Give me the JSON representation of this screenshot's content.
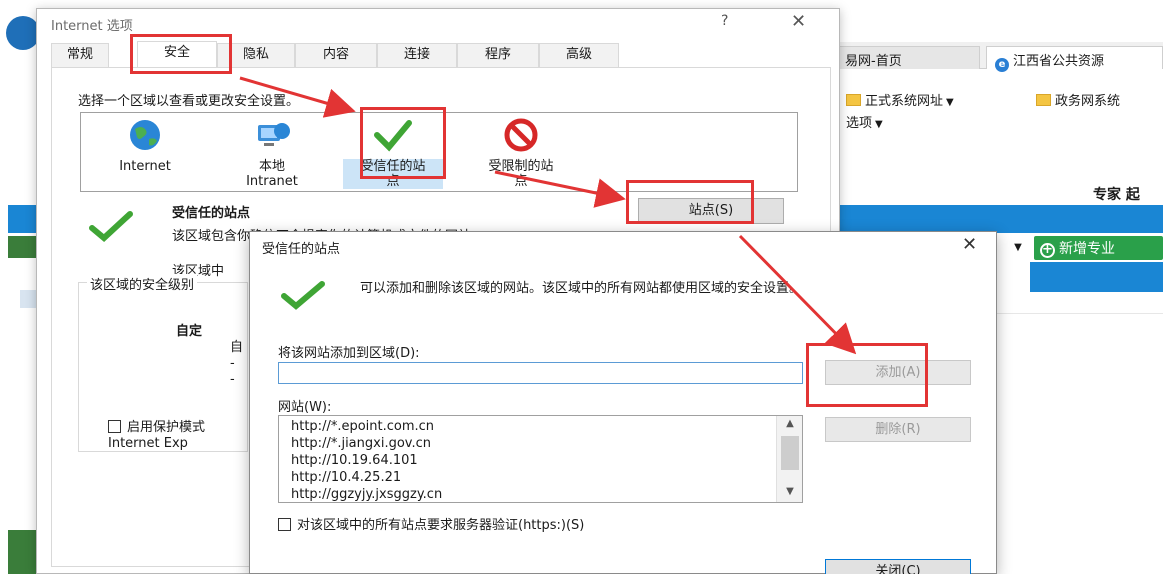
{
  "background_browser": {
    "tabs": [
      {
        "label": "易网-首页",
        "active": false
      },
      {
        "label": "江西省公共资源",
        "active": true
      }
    ],
    "favorites": [
      {
        "label": "正式系统网址"
      },
      {
        "label": "政务网系统"
      }
    ],
    "command_bar": {
      "label": "选项"
    },
    "brand_text": "专家 起",
    "add_button_label": "新增专业"
  },
  "internet_options": {
    "title": "Internet 选项",
    "help_glyph": "?",
    "close_glyph": "✕",
    "tabs": [
      "常规",
      "安全",
      "隐私",
      "内容",
      "连接",
      "程序",
      "高级"
    ],
    "active_tab": "安全",
    "instruction": "选择一个区域以查看或更改安全设置。",
    "zones": [
      {
        "icon": "globe-icon",
        "label": "Internet"
      },
      {
        "icon": "intranet-icon",
        "label": "本地\nIntranet"
      },
      {
        "icon": "checkmark-icon",
        "label": "受信任的站\n点",
        "selected": true
      },
      {
        "icon": "restricted-icon",
        "label": "受限制的站\n点"
      }
    ],
    "zone_name": "受信任的站点",
    "zone_description": "该区域包含你确信不会损害你的计算机或文件的网站。",
    "zone_description_2": "该区域中",
    "sites_button": "站点(S)",
    "security_level_label": "该区域的安全级别",
    "custom_label": "自定",
    "custom_sub": "自\n-\n-",
    "protected_mode_label": "启用保护模式",
    "protected_mode_sub": "Internet Exp"
  },
  "trusted_sites": {
    "title": "受信任的站点",
    "close_glyph": "✕",
    "info": "可以添加和删除该区域的网站。该区域中的所有网站都使用区域的安全设置。",
    "add_label": "将该网站添加到区域(D):",
    "add_input_value": "",
    "add_button": "添加(A)",
    "websites_label": "网站(W):",
    "websites": [
      "http://*.epoint.com.cn",
      "http://*.jiangxi.gov.cn",
      "http://10.19.64.101",
      "http://10.4.25.21",
      "http://ggzyjy.jxsggzy.cn"
    ],
    "remove_button": "删除(R)",
    "https_label": "对该区域中的所有站点要求服务器验证(https:)(S)",
    "close_button": "关闭(C)"
  },
  "colors": {
    "annotation_red": "#e23434",
    "check_green": "#3fa535",
    "brand_blue": "#1a86d4",
    "add_green": "#2aa04a"
  }
}
